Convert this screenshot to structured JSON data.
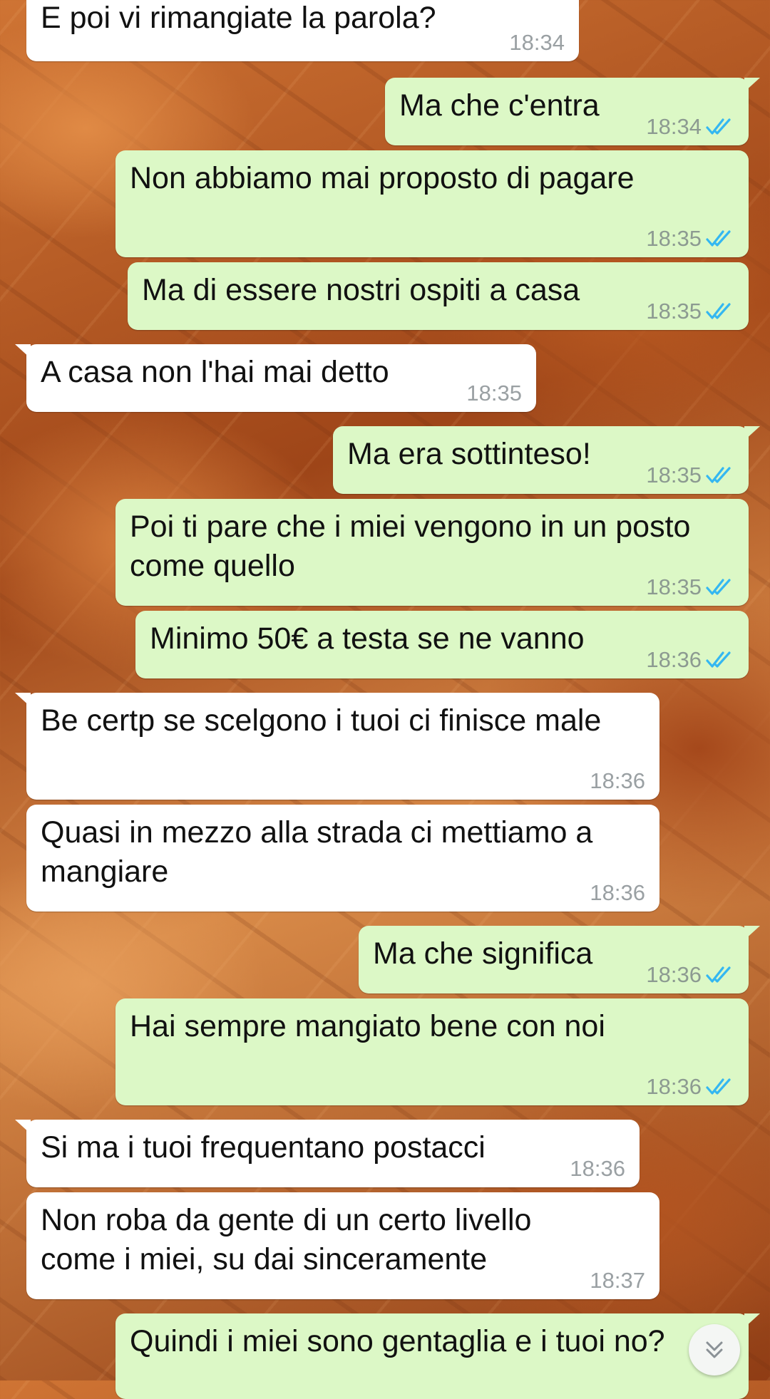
{
  "messages": [
    {
      "dir": "in",
      "text": "E poi vi rimangiate la parola?",
      "time": "18:34"
    },
    {
      "dir": "out",
      "text": "Ma che c'entra",
      "time": "18:34",
      "status": "read"
    },
    {
      "dir": "out",
      "text": "Non abbiamo mai proposto di pagare",
      "time": "18:35",
      "status": "read"
    },
    {
      "dir": "out",
      "text": "Ma di essere nostri ospiti a casa",
      "time": "18:35",
      "status": "read"
    },
    {
      "dir": "in",
      "text": "A casa non l'hai mai detto",
      "time": "18:35"
    },
    {
      "dir": "out",
      "text": "Ma era sottinteso!",
      "time": "18:35",
      "status": "read"
    },
    {
      "dir": "out",
      "text": "Poi ti pare che i miei vengono in un posto\ncome quello",
      "time": "18:35",
      "status": "read"
    },
    {
      "dir": "out",
      "text": "Minimo 50€ a testa se ne vanno",
      "time": "18:36",
      "status": "read"
    },
    {
      "dir": "in",
      "text": "Be certp se scelgono i tuoi ci finisce male",
      "time": "18:36"
    },
    {
      "dir": "in",
      "text": "Quasi in mezzo alla strada ci mettiamo a\nmangiare",
      "time": "18:36"
    },
    {
      "dir": "out",
      "text": "Ma che significa",
      "time": "18:36",
      "status": "read"
    },
    {
      "dir": "out",
      "text": "Hai sempre mangiato bene con noi",
      "time": "18:36",
      "status": "read"
    },
    {
      "dir": "in",
      "text": "Si ma i tuoi frequentano postacci",
      "time": "18:36"
    },
    {
      "dir": "in",
      "text": "Non roba da gente di un certo livello\ncome i miei, su dai sinceramente",
      "time": "18:37"
    },
    {
      "dir": "out",
      "text": "Quindi i miei sono gentaglia e i tuoi no?",
      "time": "",
      "status": ""
    }
  ],
  "icons": {
    "read_receipt": "double-check-icon",
    "scroll_down": "chevrons-down-icon"
  },
  "colors": {
    "incoming_bubble": "#ffffff",
    "outgoing_bubble": "#dcf8c6",
    "read_check": "#34b7f1",
    "timestamp": "#8c9a91"
  }
}
